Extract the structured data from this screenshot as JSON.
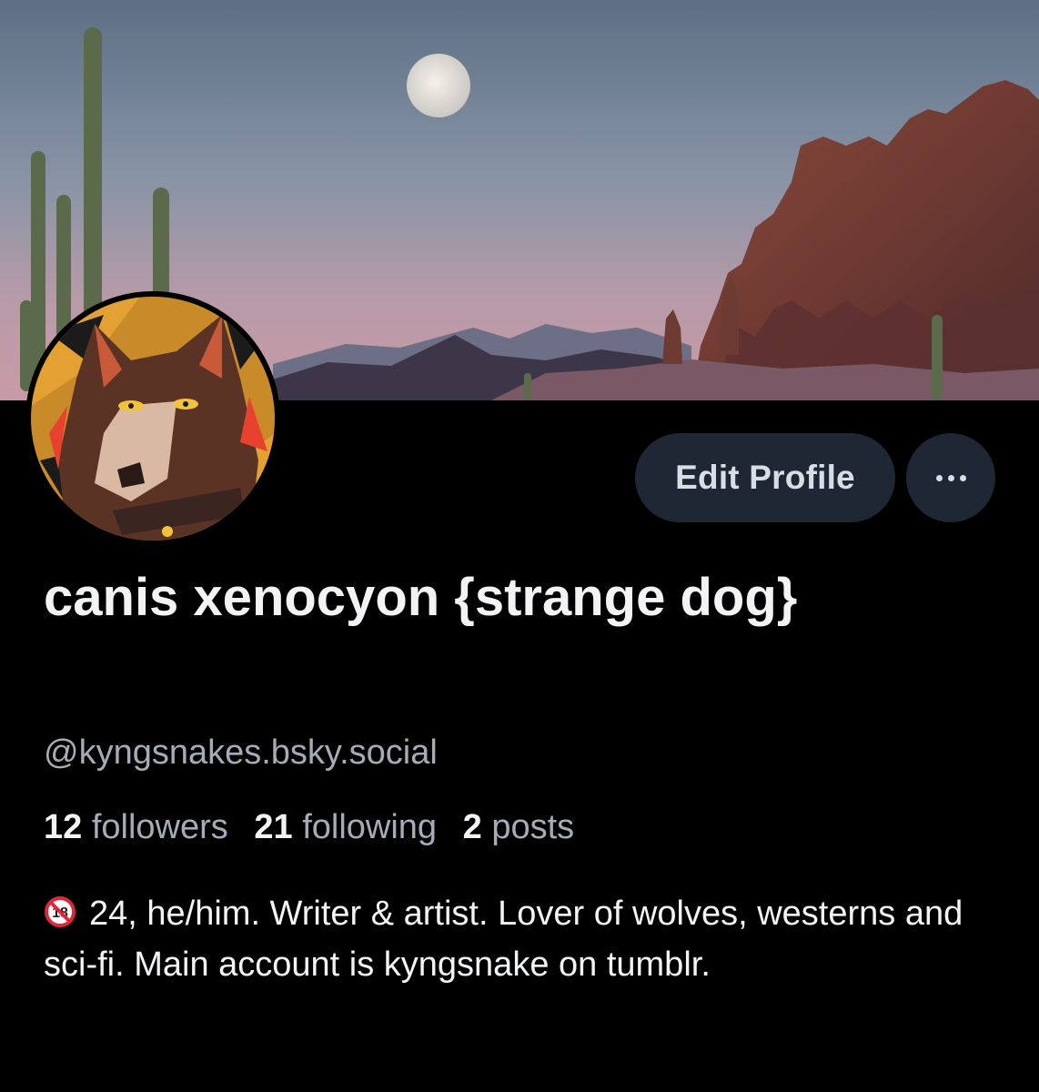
{
  "profile": {
    "display_name": "canis xenocyon {strange dog}",
    "handle": "@kyngsnakes.bsky.social",
    "edit_label": "Edit Profile",
    "stats": [
      {
        "value": "12",
        "label": "followers"
      },
      {
        "value": "21",
        "label": "following"
      },
      {
        "value": "2",
        "label": "posts"
      }
    ],
    "bio_icon": "no-under-18-icon",
    "bio_icon_text": "18",
    "bio": "24, he/him. Writer & artist. Lover of wolves, westerns and sci-fi. Main account is kyngsnake on tumblr."
  },
  "icons": {
    "more": "more-options-icon",
    "bio": "no-under-18-icon"
  },
  "colors": {
    "background": "#000000",
    "button_bg": "#1e2733",
    "secondary_text": "#a4acb7",
    "primary_text": "#f1f3f5",
    "age_icon_red": "#e0263a"
  }
}
